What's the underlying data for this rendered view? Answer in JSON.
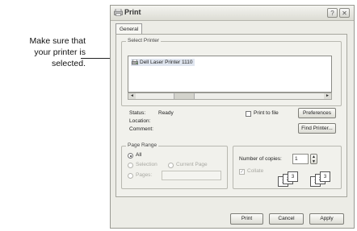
{
  "callout": {
    "line1": "Make sure that",
    "line2": "your printer is",
    "line3": "selected."
  },
  "dialog": {
    "title": "Print",
    "help_label": "?",
    "close_label": "✕",
    "tab_label": "General",
    "select_printer": {
      "group_label": "Select Printer",
      "printer_name": "Dell Laser Printer 1110",
      "scroll_left": "◄",
      "scroll_right": "►"
    },
    "status": {
      "status_label": "Status:",
      "status_value": "Ready",
      "location_label": "Location:",
      "location_value": "",
      "comment_label": "Comment:",
      "comment_value": "",
      "print_to_file_label": "Print to file",
      "print_to_file_checked": false,
      "preferences_label": "Preferences",
      "find_printer_label": "Find Printer..."
    },
    "page_range": {
      "group_label": "Page Range",
      "all_label": "All",
      "selection_label": "Selection",
      "current_page_label": "Current Page",
      "pages_label": "Pages:",
      "pages_value": ""
    },
    "copies": {
      "label": "Number of copies:",
      "value": "1",
      "collate_label": "Collate",
      "collate_checked": true
    },
    "buttons": {
      "print": "Print",
      "cancel": "Cancel",
      "apply": "Apply"
    }
  }
}
